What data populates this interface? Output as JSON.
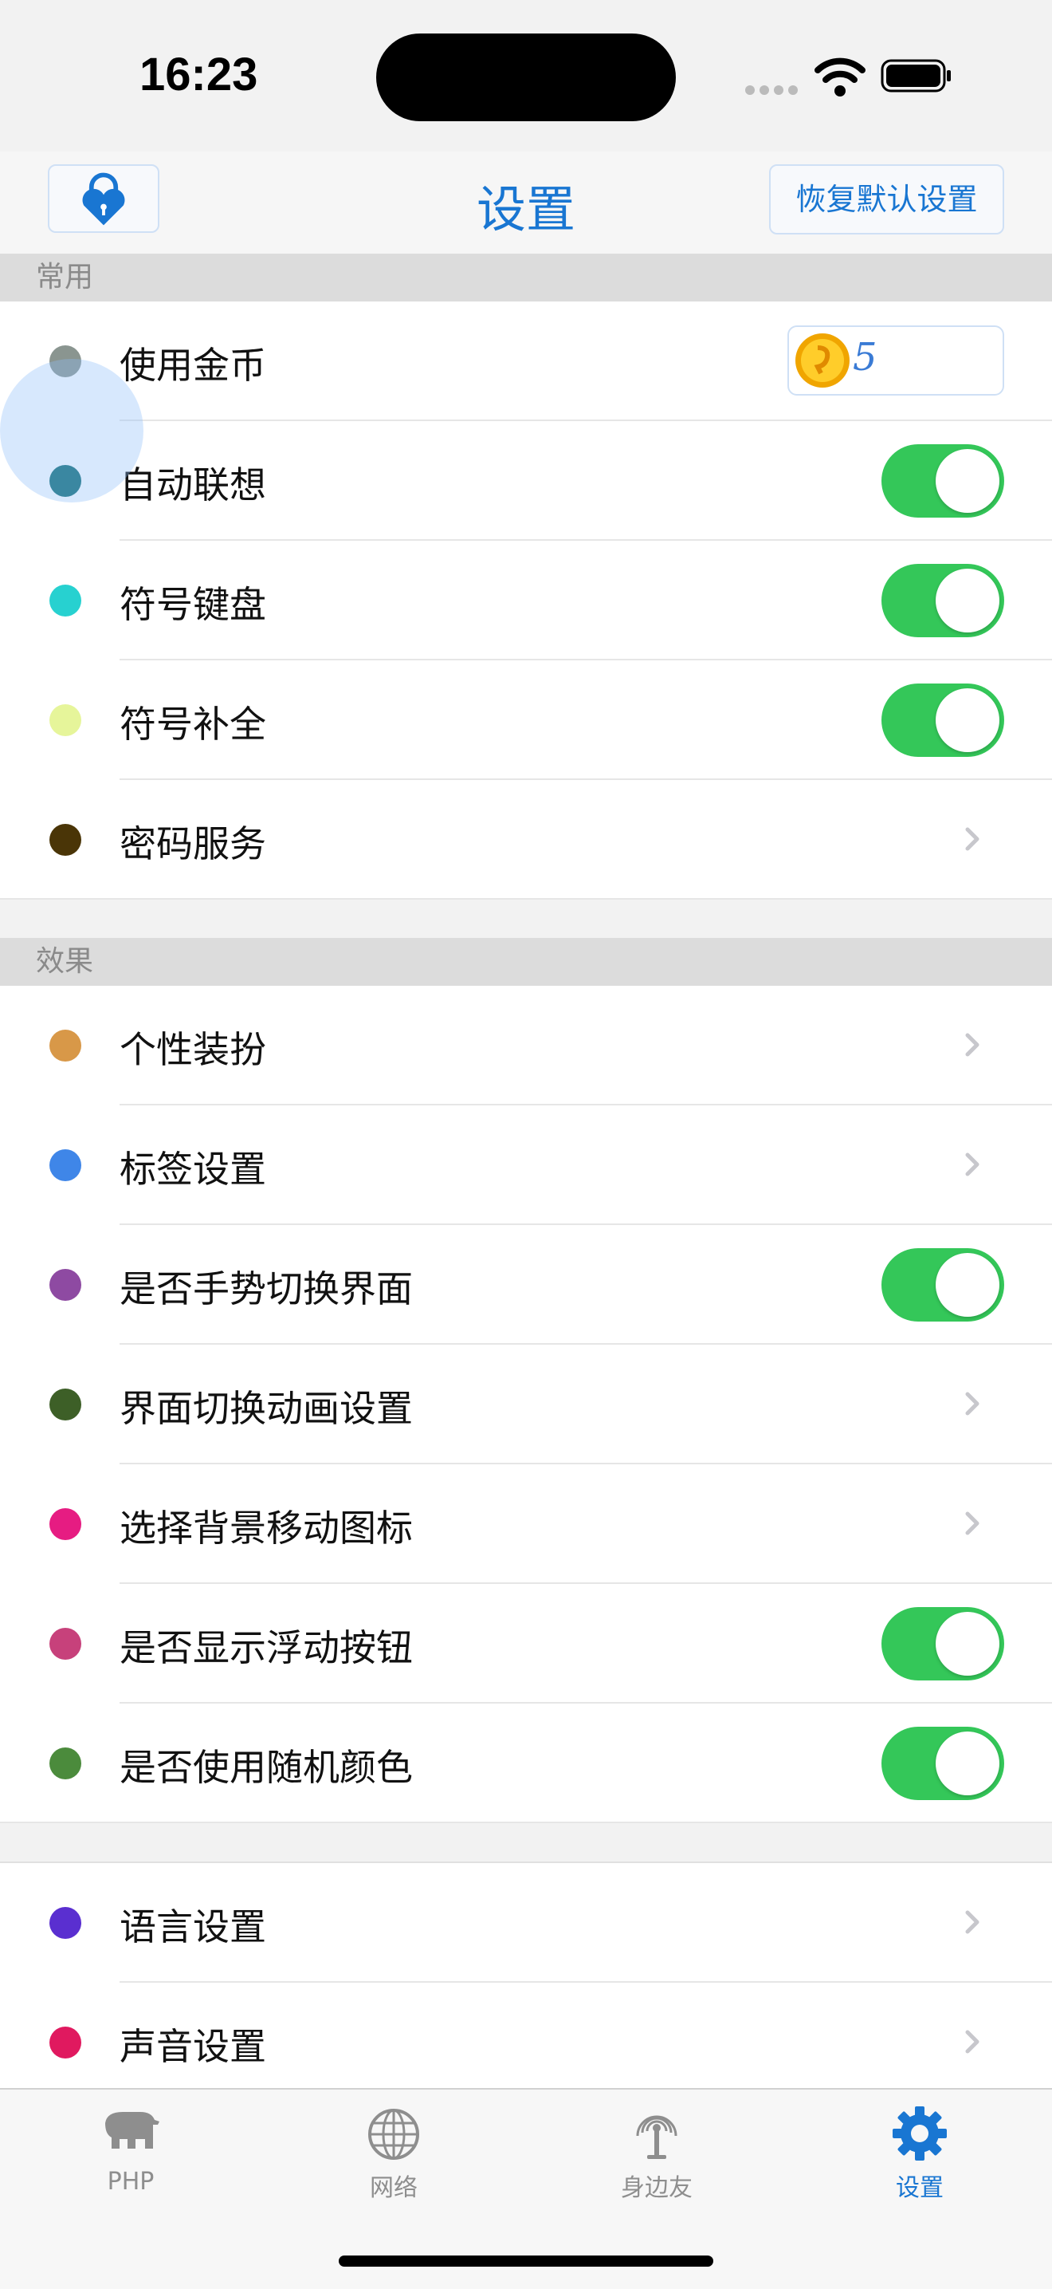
{
  "status_bar": {
    "time": "16:23"
  },
  "navbar": {
    "title": "设置",
    "reset_label": "恢复默认设置"
  },
  "sections": [
    {
      "header": "常用",
      "rows": [
        {
          "label": "使用金币",
          "dot_color": "#8a9590",
          "control": "coin",
          "value": "5"
        },
        {
          "label": "自动联想",
          "dot_color": "#0e6a72",
          "control": "toggle",
          "on": true
        },
        {
          "label": "符号键盘",
          "dot_color": "#27d1d0",
          "control": "toggle",
          "on": true
        },
        {
          "label": "符号补全",
          "dot_color": "#e6f59a",
          "control": "toggle",
          "on": true
        },
        {
          "label": "密码服务",
          "dot_color": "#4a3507",
          "control": "chevron"
        }
      ]
    },
    {
      "header": "效果",
      "rows": [
        {
          "label": "个性装扮",
          "dot_color": "#d89848",
          "control": "chevron"
        },
        {
          "label": "标签设置",
          "dot_color": "#3f86e8",
          "control": "chevron"
        },
        {
          "label": "是否手势切换界面",
          "dot_color": "#8e4aa2",
          "control": "toggle",
          "on": true
        },
        {
          "label": "界面切换动画设置",
          "dot_color": "#3d5f27",
          "control": "chevron"
        },
        {
          "label": "选择背景移动图标",
          "dot_color": "#e61c82",
          "control": "chevron"
        },
        {
          "label": "是否显示浮动按钮",
          "dot_color": "#c7417b",
          "control": "toggle",
          "on": true
        },
        {
          "label": "是否使用随机颜色",
          "dot_color": "#4b8b3c",
          "control": "toggle",
          "on": true
        }
      ]
    },
    {
      "header": "",
      "rows": [
        {
          "label": "语言设置",
          "dot_color": "#5a2fd0",
          "control": "chevron"
        },
        {
          "label": "声音设置",
          "dot_color": "#e0195f",
          "control": "chevron"
        }
      ]
    }
  ],
  "tabbar": {
    "tabs": [
      {
        "label": "PHP",
        "icon": "elephant-icon",
        "active": false
      },
      {
        "label": "网络",
        "icon": "globe-icon",
        "active": false
      },
      {
        "label": "身边友",
        "icon": "antenna-icon",
        "active": false
      },
      {
        "label": "设置",
        "icon": "gear-icon",
        "active": true
      }
    ]
  },
  "colors": {
    "accent": "#1976d2",
    "toggle_on": "#34c759"
  }
}
